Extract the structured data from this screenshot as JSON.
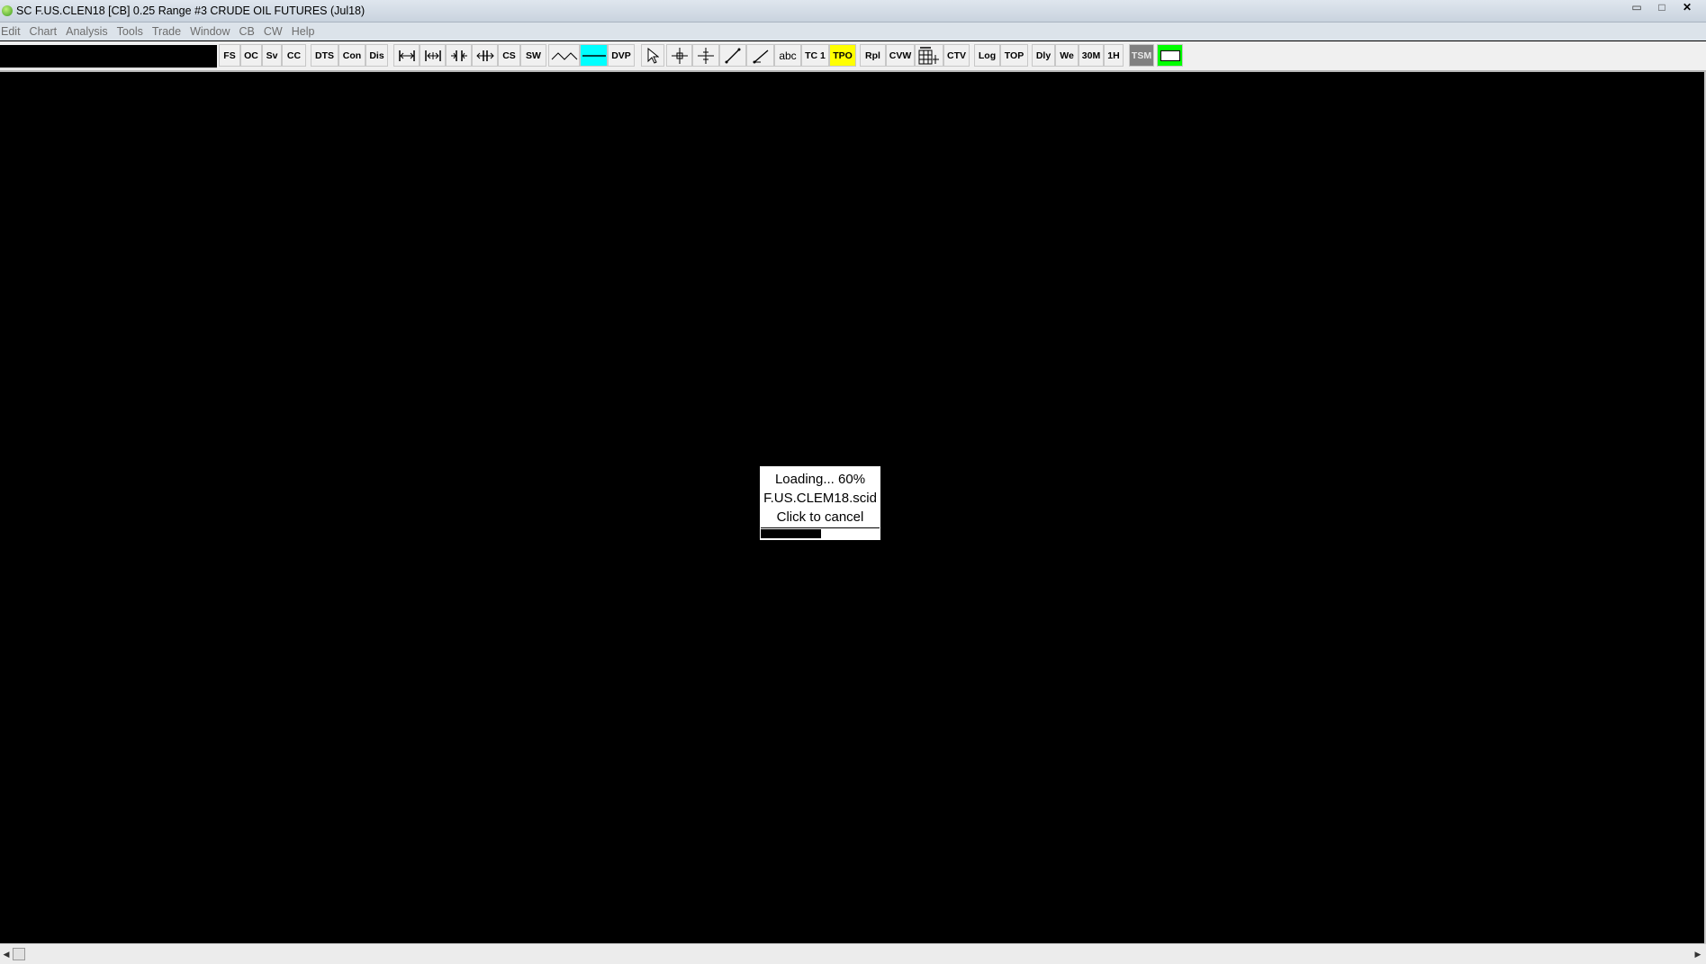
{
  "window": {
    "title": "SC F.US.CLEN18 [CB]  0.25 Range  #3  CRUDE OIL FUTURES (Jul18)",
    "controls": {
      "minimize": "▭",
      "maximize": "□",
      "close": "✕"
    }
  },
  "menu": {
    "items": [
      "Edit",
      "Chart",
      "Analysis",
      "Tools",
      "Trade",
      "Window",
      "CB",
      "CW",
      "Help"
    ]
  },
  "toolbar": {
    "symbol_input": "",
    "buttons": {
      "fs": "FS",
      "oc": "OC",
      "sv": "Sv",
      "cc": "CC",
      "dts": "DTS",
      "con": "Con",
      "dis": "Dis",
      "cs": "CS",
      "sw": "SW",
      "dvp": "DVP",
      "abc": "abc",
      "tc1": "TC 1",
      "tpo": "TPO",
      "rpl": "Rpl",
      "cvw": "CVW",
      "ctv": "CTV",
      "log": "Log",
      "top": "TOP",
      "dly": "Dly",
      "we": "We",
      "30m": "30M",
      "1h": "1H",
      "tsm": "TSM"
    },
    "colors": {
      "tpo_bg": "#ffff00",
      "line_bg": "#00ffff",
      "tsm_bg": "#808080",
      "color_swatch": "#00ff00"
    }
  },
  "loading": {
    "status": "Loading... 60%",
    "file": "F.US.CLEM18.scid",
    "action": "Click to cancel",
    "progress_percent": 60
  },
  "scrollbar": {
    "left_arrow": "◀",
    "right_arrow": "▶"
  }
}
